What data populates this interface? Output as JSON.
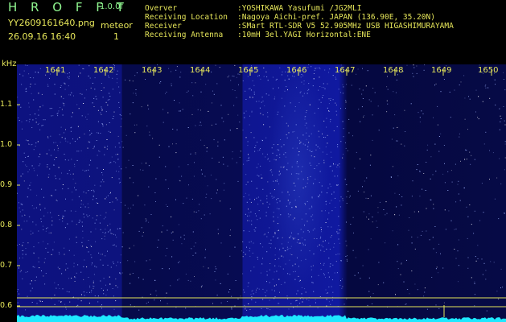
{
  "header": {
    "title": "H R O F F T",
    "version": "1.0.0f",
    "file_name": "YY2609161640.png",
    "timestamp": "26.09.16 16:40",
    "meteor_label": "meteor",
    "meteor_count": "1"
  },
  "info": [
    {
      "key": "Overver",
      "value": ":YOSHIKAWA Yasufumi /JG2MLI"
    },
    {
      "key": "Receiving Location",
      "value": ":Nagoya Aichi-pref. JAPAN (136.90E, 35.20N)"
    },
    {
      "key": "Receiver",
      "value": ":SMart RTL-SDR V5 52.905MHz USB HIGASHIMURAYAMA"
    },
    {
      "key": "Receiving Antenna",
      "value": ":10mH 3el.YAGI Horizontal:ENE"
    }
  ],
  "y_axis": {
    "unit": "kHz",
    "ticks": [
      "1.1",
      "1.0",
      "0.9",
      "0.8",
      "0.7",
      "0.6"
    ]
  },
  "x_axis": {
    "ticks": [
      "1641",
      "1642",
      "1643",
      "1644",
      "1645",
      "1646",
      "1647",
      "1648",
      "1649",
      "1650"
    ]
  },
  "colors": {
    "text_yellow": "#e6e65a",
    "title_green": "#8ff58f",
    "noise_dot": "#9fb4ff",
    "spectrum_cyan": "#1ee8ff",
    "marker_line": "#e6e65a"
  }
}
